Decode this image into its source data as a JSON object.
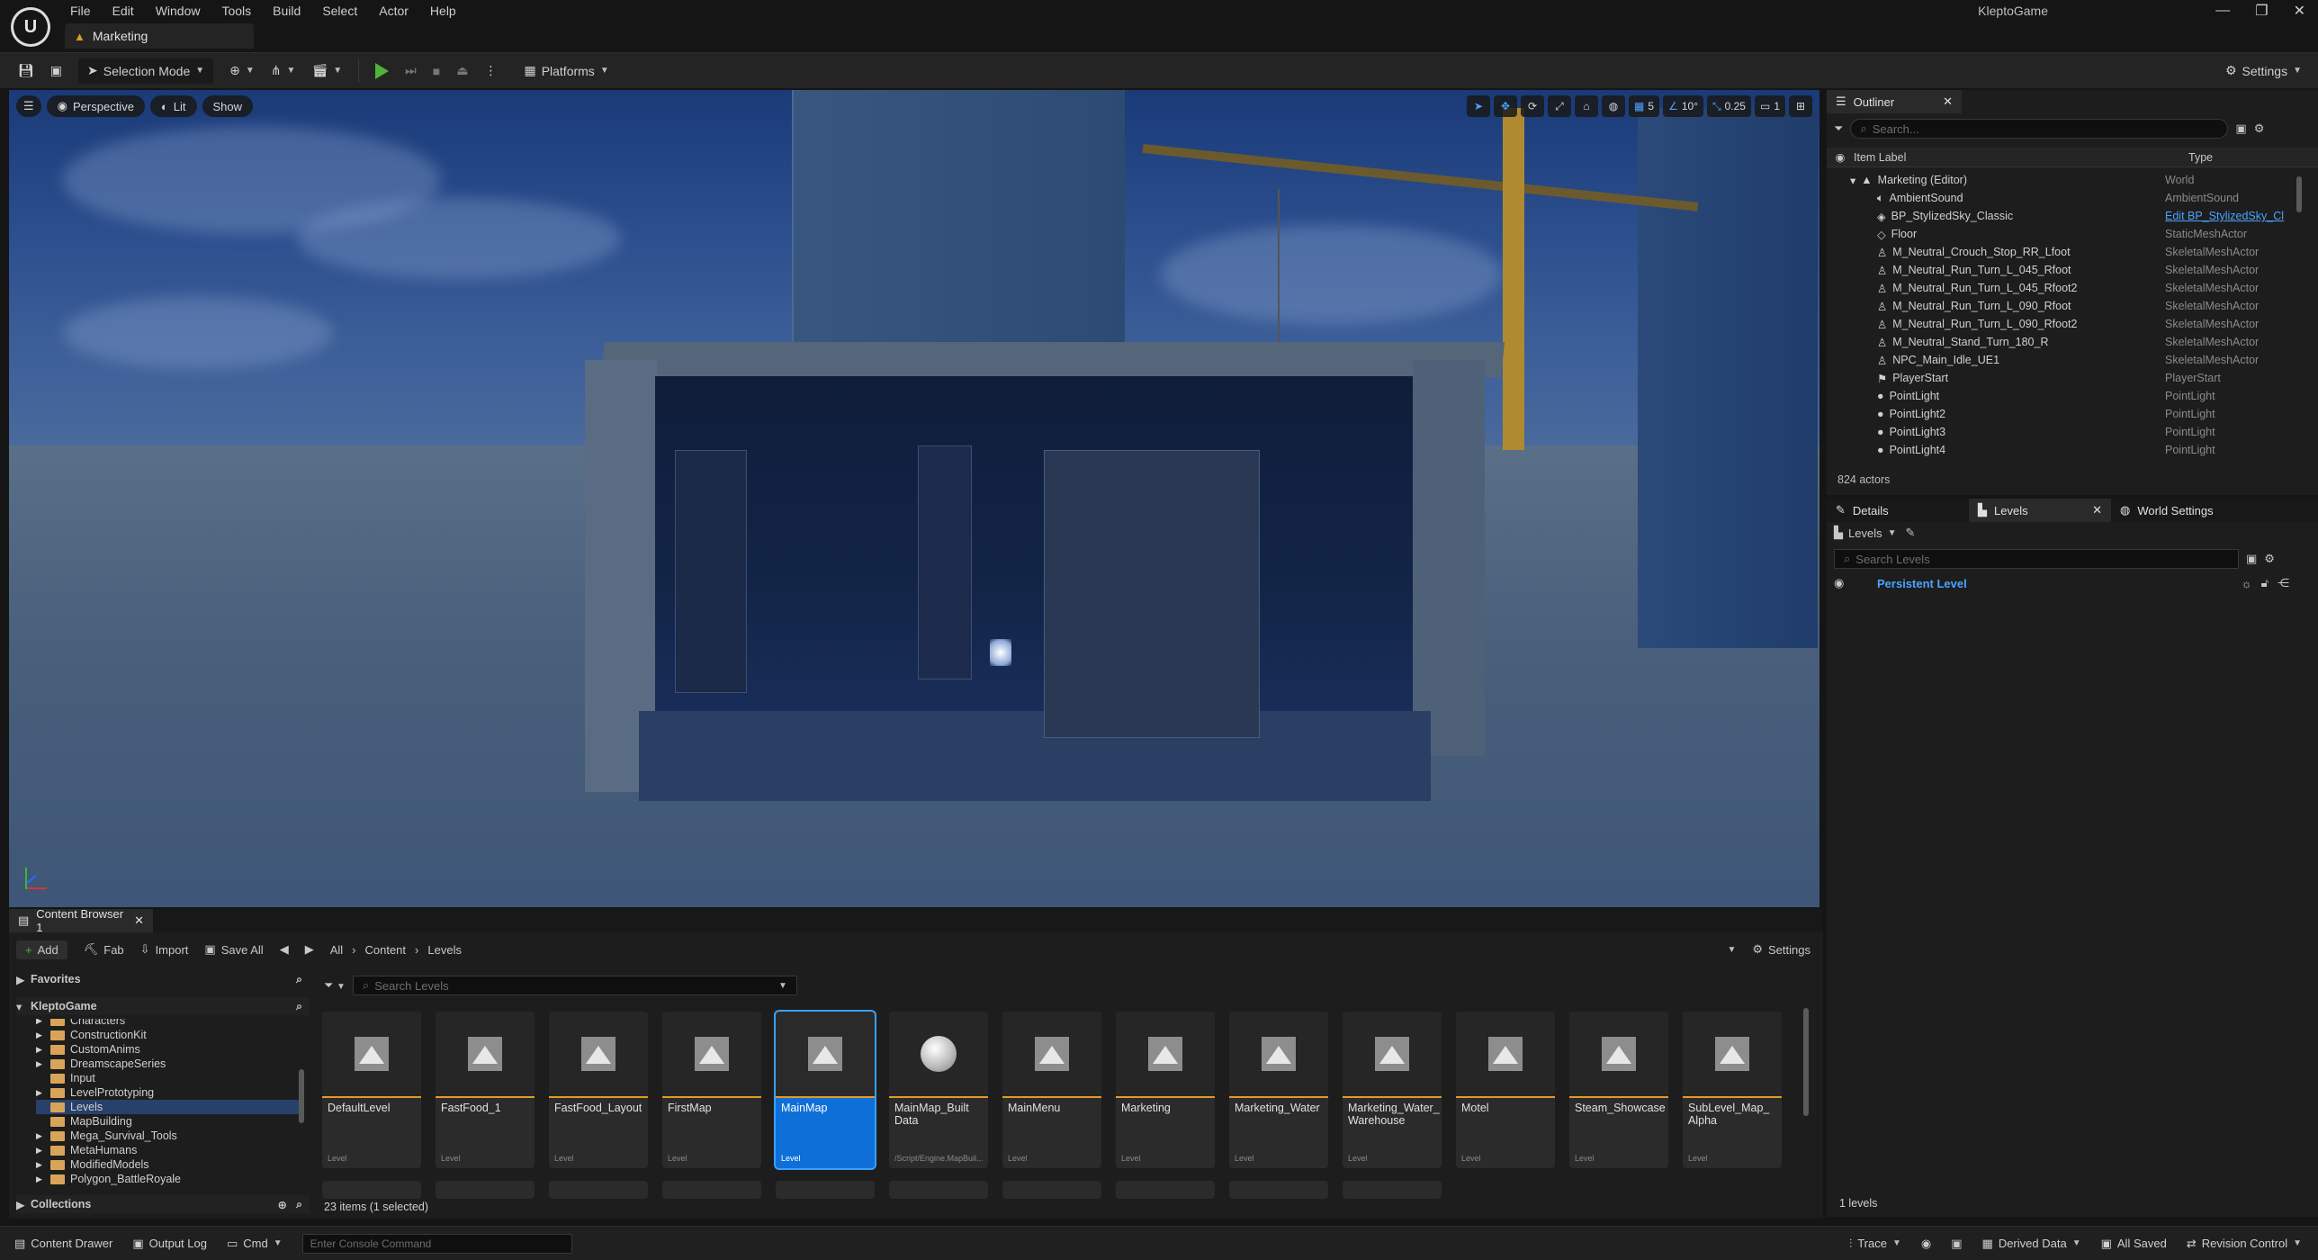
{
  "window": {
    "project_name": "KleptoGame",
    "document_tab": "Marketing",
    "controls": [
      "—",
      "❐",
      "✕"
    ]
  },
  "menu": [
    "File",
    "Edit",
    "Window",
    "Tools",
    "Build",
    "Select",
    "Actor",
    "Help"
  ],
  "toolbar": {
    "selection_mode": "Selection Mode",
    "platforms": "Platforms",
    "settings": "Settings"
  },
  "viewport": {
    "perspective": "Perspective",
    "lit": "Lit",
    "show": "Show",
    "grid_snap": "5",
    "rotation_snap": "10°",
    "scale_snap": "0.25",
    "camera_speed": "1"
  },
  "outliner": {
    "tab": "Outliner",
    "search_placeholder": "Search...",
    "col_label": "Item Label",
    "col_type": "Type",
    "actors_count": "824 actors",
    "rows": [
      {
        "label": "Marketing (Editor)",
        "type": "World"
      },
      {
        "label": "AmbientSound",
        "type": "AmbientSound"
      },
      {
        "label": "BP_StylizedSky_Classic",
        "type": "Edit BP_StylizedSky_Cl"
      },
      {
        "label": "Floor",
        "type": "StaticMeshActor"
      },
      {
        "label": "M_Neutral_Crouch_Stop_RR_Lfoot",
        "type": "SkeletalMeshActor"
      },
      {
        "label": "M_Neutral_Run_Turn_L_045_Rfoot",
        "type": "SkeletalMeshActor"
      },
      {
        "label": "M_Neutral_Run_Turn_L_045_Rfoot2",
        "type": "SkeletalMeshActor"
      },
      {
        "label": "M_Neutral_Run_Turn_L_090_Rfoot",
        "type": "SkeletalMeshActor"
      },
      {
        "label": "M_Neutral_Run_Turn_L_090_Rfoot2",
        "type": "SkeletalMeshActor"
      },
      {
        "label": "M_Neutral_Stand_Turn_180_R",
        "type": "SkeletalMeshActor"
      },
      {
        "label": "NPC_Main_Idle_UE1",
        "type": "SkeletalMeshActor"
      },
      {
        "label": "PlayerStart",
        "type": "PlayerStart"
      },
      {
        "label": "PointLight",
        "type": "PointLight"
      },
      {
        "label": "PointLight2",
        "type": "PointLight"
      },
      {
        "label": "PointLight3",
        "type": "PointLight"
      },
      {
        "label": "PointLight4",
        "type": "PointLight"
      }
    ]
  },
  "levels_panel": {
    "tab_details": "Details",
    "tab_levels": "Levels",
    "tab_world_settings": "World Settings",
    "levels_dropdown": "Levels",
    "search_placeholder": "Search Levels",
    "persistent_level": "Persistent Level",
    "levels_count": "1 levels"
  },
  "content_browser": {
    "tab": "Content Browser 1",
    "add": "Add",
    "fab": "Fab",
    "import": "Import",
    "save_all": "Save All",
    "breadcrumb": [
      "All",
      "Content",
      "Levels"
    ],
    "settings": "Settings",
    "favorites": "Favorites",
    "project_root": "KleptoGame",
    "collections": "Collections",
    "search_placeholder": "Search Levels",
    "items_status": "23 items (1 selected)",
    "folders": [
      "Characters",
      "ConstructionKit",
      "CustomAnims",
      "DreamscapeSeries",
      "Input",
      "LevelPrototyping",
      "Levels",
      "MapBuilding",
      "Mega_Survival_Tools",
      "MetaHumans",
      "ModifiedModels",
      "Polygon_BattleRoyale"
    ],
    "selected_folder": "Levels",
    "assets": [
      {
        "name": "DefaultLevel",
        "type": "Level"
      },
      {
        "name": "FastFood_1",
        "type": "Level"
      },
      {
        "name": "FastFood_Layout",
        "type": "Level"
      },
      {
        "name": "FirstMap",
        "type": "Level"
      },
      {
        "name": "MainMap",
        "type": "Level"
      },
      {
        "name": "MainMap_Built Data",
        "type": "/Script/Engine.MapBuil..."
      },
      {
        "name": "MainMenu",
        "type": "Level"
      },
      {
        "name": "Marketing",
        "type": "Level"
      },
      {
        "name": "Marketing_Water",
        "type": "Level"
      },
      {
        "name": "Marketing_Water_ Warehouse",
        "type": "Level"
      },
      {
        "name": "Motel",
        "type": "Level"
      },
      {
        "name": "Steam_Showcase",
        "type": "Level"
      },
      {
        "name": "SubLevel_Map_ Alpha",
        "type": "Level"
      }
    ],
    "selected_asset": "MainMap"
  },
  "statusbar": {
    "content_drawer": "Content Drawer",
    "output_log": "Output Log",
    "cmd": "Cmd",
    "console_placeholder": "Enter Console Command",
    "trace": "Trace",
    "derived_data": "Derived Data",
    "all_saved": "All Saved",
    "revision_control": "Revision Control"
  },
  "colors": {
    "accent": "#0f6fd8",
    "play_green": "#4fb33a",
    "level_underline": "#e59a23",
    "link_blue": "#4aa3ff"
  }
}
